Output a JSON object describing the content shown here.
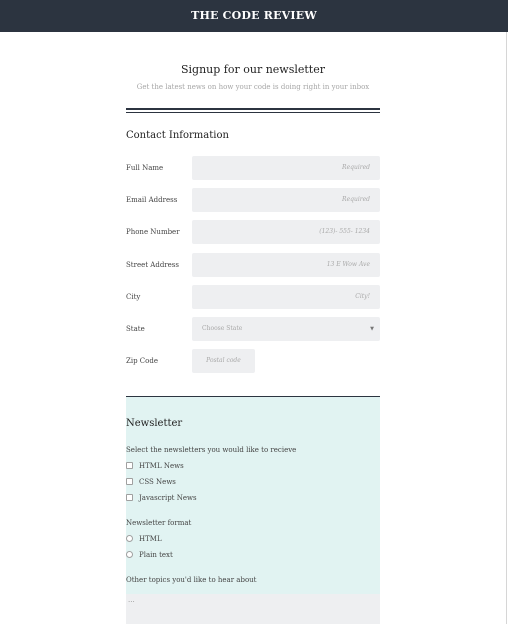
{
  "header": {
    "site_title": "THE CODE REVIEW"
  },
  "intro": {
    "title": "Signup for our newsletter",
    "subtitle": "Get the latest news on how your code is doing right in your inbox"
  },
  "contact": {
    "heading": "Contact Information",
    "fields": [
      {
        "label": "Full Name",
        "placeholder": "Required"
      },
      {
        "label": "Email Address",
        "placeholder": "Required"
      },
      {
        "label": "Phone Number",
        "placeholder": "(123)- 555- 1234"
      },
      {
        "label": "Street Address",
        "placeholder": "13 E Wow Ave"
      },
      {
        "label": "City",
        "placeholder": "City!"
      }
    ],
    "state": {
      "label": "State",
      "selected": "Choose State",
      "arrow": "▼"
    },
    "zip": {
      "label": "Zip Code",
      "placeholder": "Postal code"
    }
  },
  "newsletter": {
    "heading": "Newsletter",
    "select_prompt": "Select the newsletters you would like to recieve",
    "options": [
      "HTML News",
      "CSS News",
      "Javascript News"
    ],
    "format_label": "Newsletter format",
    "formats": [
      "HTML",
      "Plain text"
    ],
    "topics_label": "Other topics you'd like to hear about",
    "topics_value": "..."
  },
  "colors": {
    "header_bg": "#2c3440",
    "panel_bg": "#e1f3f2",
    "input_bg": "#eeeff1"
  }
}
